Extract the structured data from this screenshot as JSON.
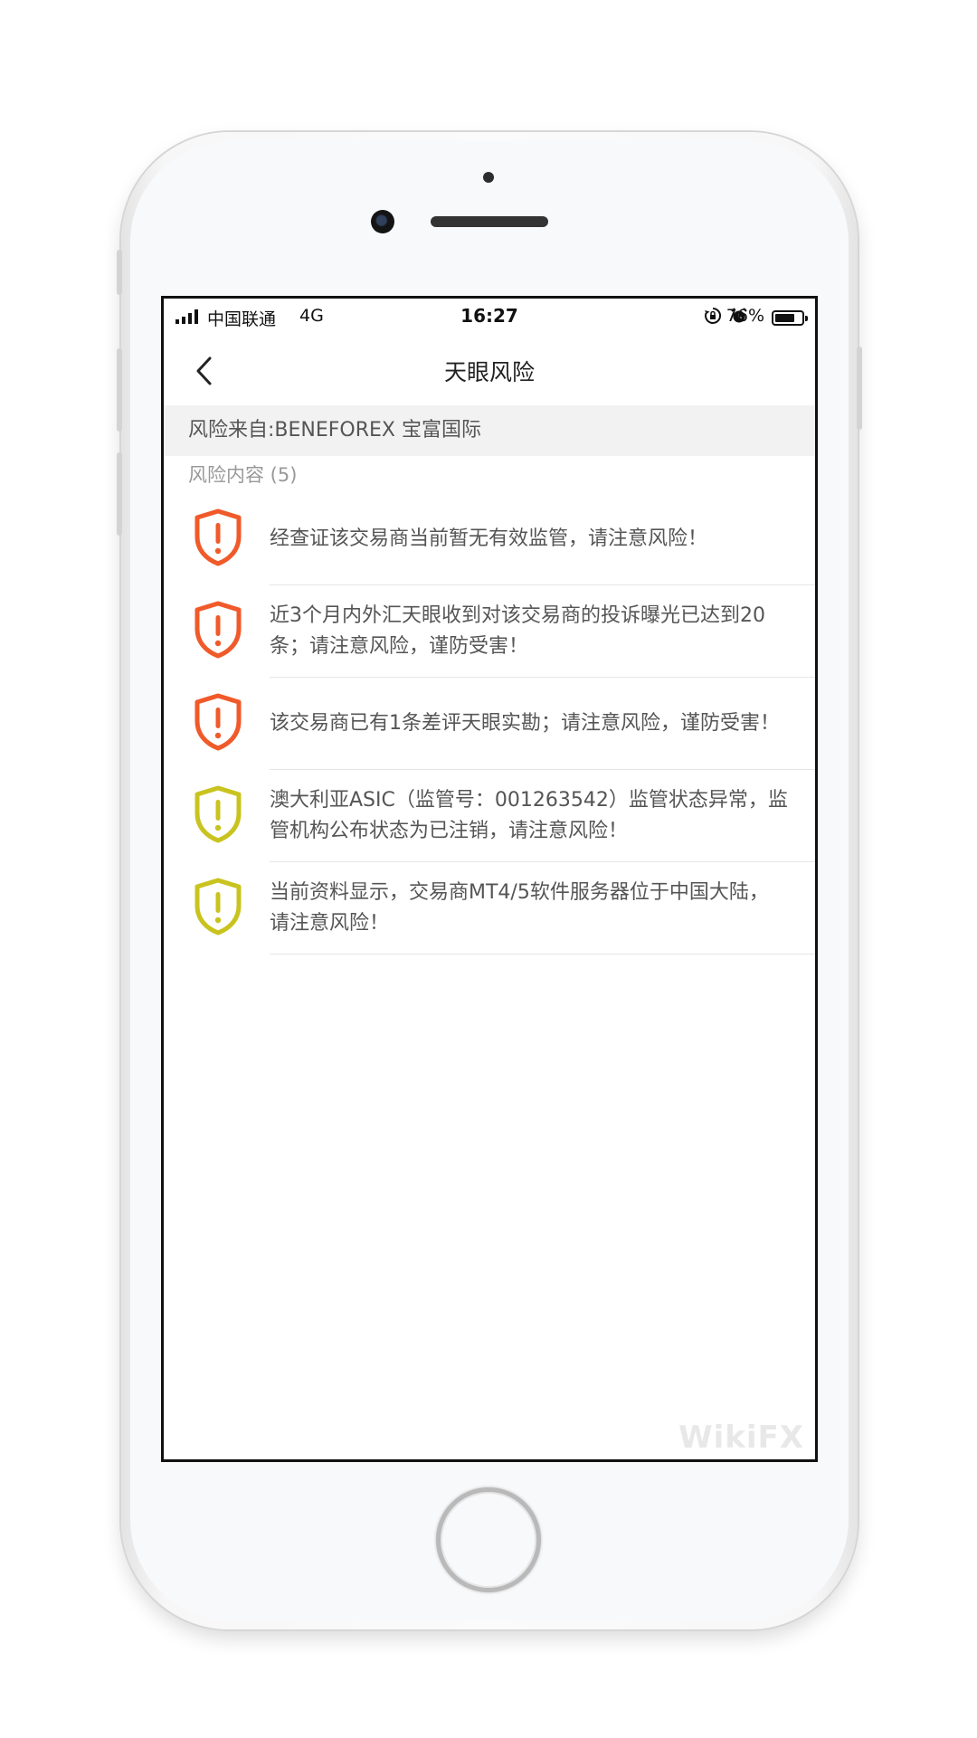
{
  "status_bar": {
    "carrier": "中国联通",
    "network": "4G",
    "time": "16:27",
    "battery_percent": "76%",
    "battery_level": 0.76,
    "icons": [
      "signal-icon",
      "rotation-lock-icon",
      "alarm-icon",
      "battery-icon"
    ]
  },
  "nav": {
    "back_icon": "chevron-left-icon",
    "title": "天眼风险"
  },
  "source": {
    "text": "风险来自:BENEFOREX 宝富国际"
  },
  "section": {
    "title": "风险内容 (5)"
  },
  "colors": {
    "high_risk": "#f05a2a",
    "medium_risk": "#c9c31f",
    "text": "#555555",
    "muted": "#999999"
  },
  "risks": [
    {
      "level": "high",
      "icon": "shield-alert-icon",
      "text": "经查证该交易商当前暂无有效监管，请注意风险！"
    },
    {
      "level": "high",
      "icon": "shield-alert-icon",
      "text": "近3个月内外汇天眼收到对该交易商的投诉曝光已达到20条；请注意风险，谨防受害！"
    },
    {
      "level": "high",
      "icon": "shield-alert-icon",
      "text": "该交易商已有1条差评天眼实勘；请注意风险，谨防受害！"
    },
    {
      "level": "medium",
      "icon": "shield-alert-icon",
      "text": "澳大利亚ASIC（监管号：001263542）监管状态异常，监管机构公布状态为已注销，请注意风险！"
    },
    {
      "level": "medium",
      "icon": "shield-alert-icon",
      "text": "当前资料显示，交易商MT4/5软件服务器位于中国大陆，请注意风险！"
    }
  ],
  "watermark": "WikiFX"
}
